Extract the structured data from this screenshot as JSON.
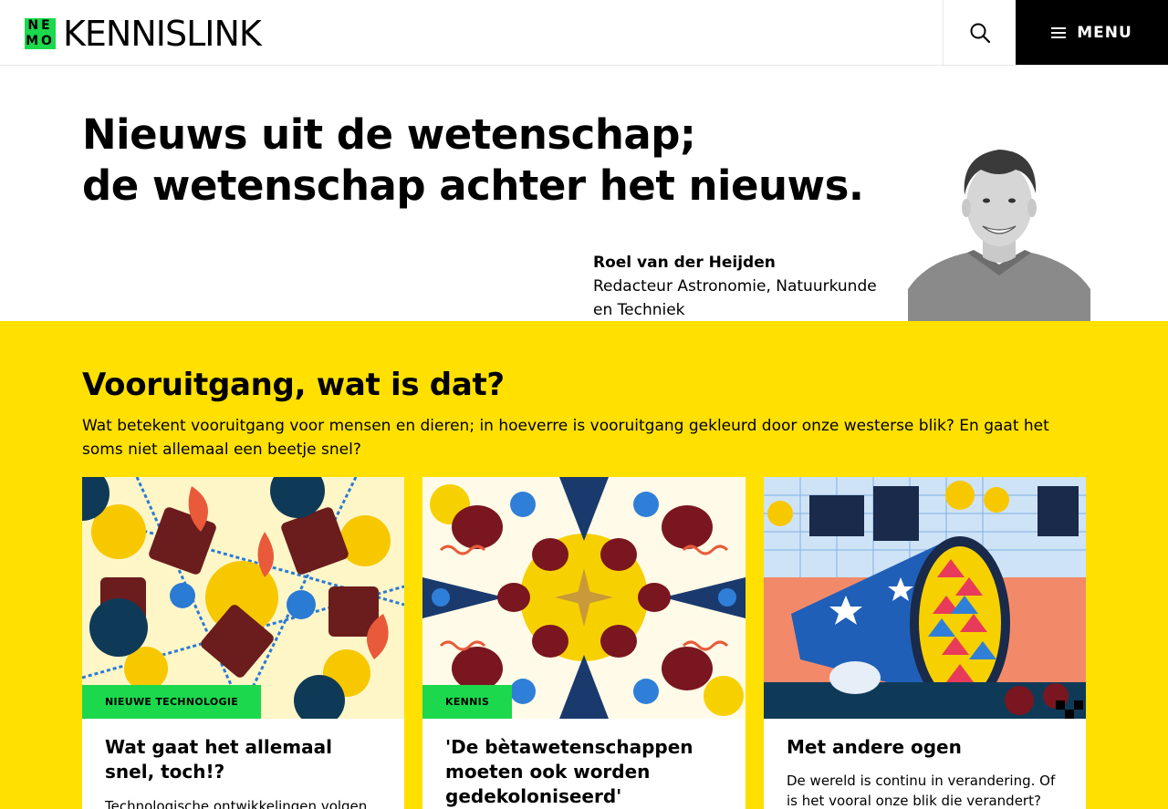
{
  "header": {
    "logo_mark": [
      "NE",
      "MO"
    ],
    "logo_text": "KENNISLINK",
    "menu_label": "MENU",
    "search_icon": "search-icon",
    "menu_icon": "hamburger-icon"
  },
  "hero": {
    "title_line1": "Nieuws uit de wetenschap;",
    "title_line2": "de wetenschap achter het nieuws.",
    "author_name": "Roel van der Heijden",
    "author_role": "Redacteur Astronomie, Natuurkunde en Techniek"
  },
  "dossier": {
    "title": "Vooruitgang, wat is dat?",
    "description": "Wat betekent vooruitgang voor mensen en dieren; in hoeverre is vooruitgang gekleurd door onze westerse blik? En gaat het soms niet allemaal een beetje snel?"
  },
  "cards": [
    {
      "tag": "NIEUWE TECHNOLOGIE",
      "title": "Wat gaat het allemaal snel, toch!?",
      "text": "Technologische ontwikkelingen volgen"
    },
    {
      "tag": "KENNIS",
      "title": "'De bètawetenschappen moeten ook worden gedekoloniseerd'",
      "text": ""
    },
    {
      "tag": "",
      "title": "Met andere ogen",
      "text": "De wereld is continu in verandering. Of is het vooral onze blik die verandert?"
    }
  ],
  "colors": {
    "accent_green": "#1bd84c",
    "accent_yellow": "#ffe000",
    "black": "#000000"
  }
}
